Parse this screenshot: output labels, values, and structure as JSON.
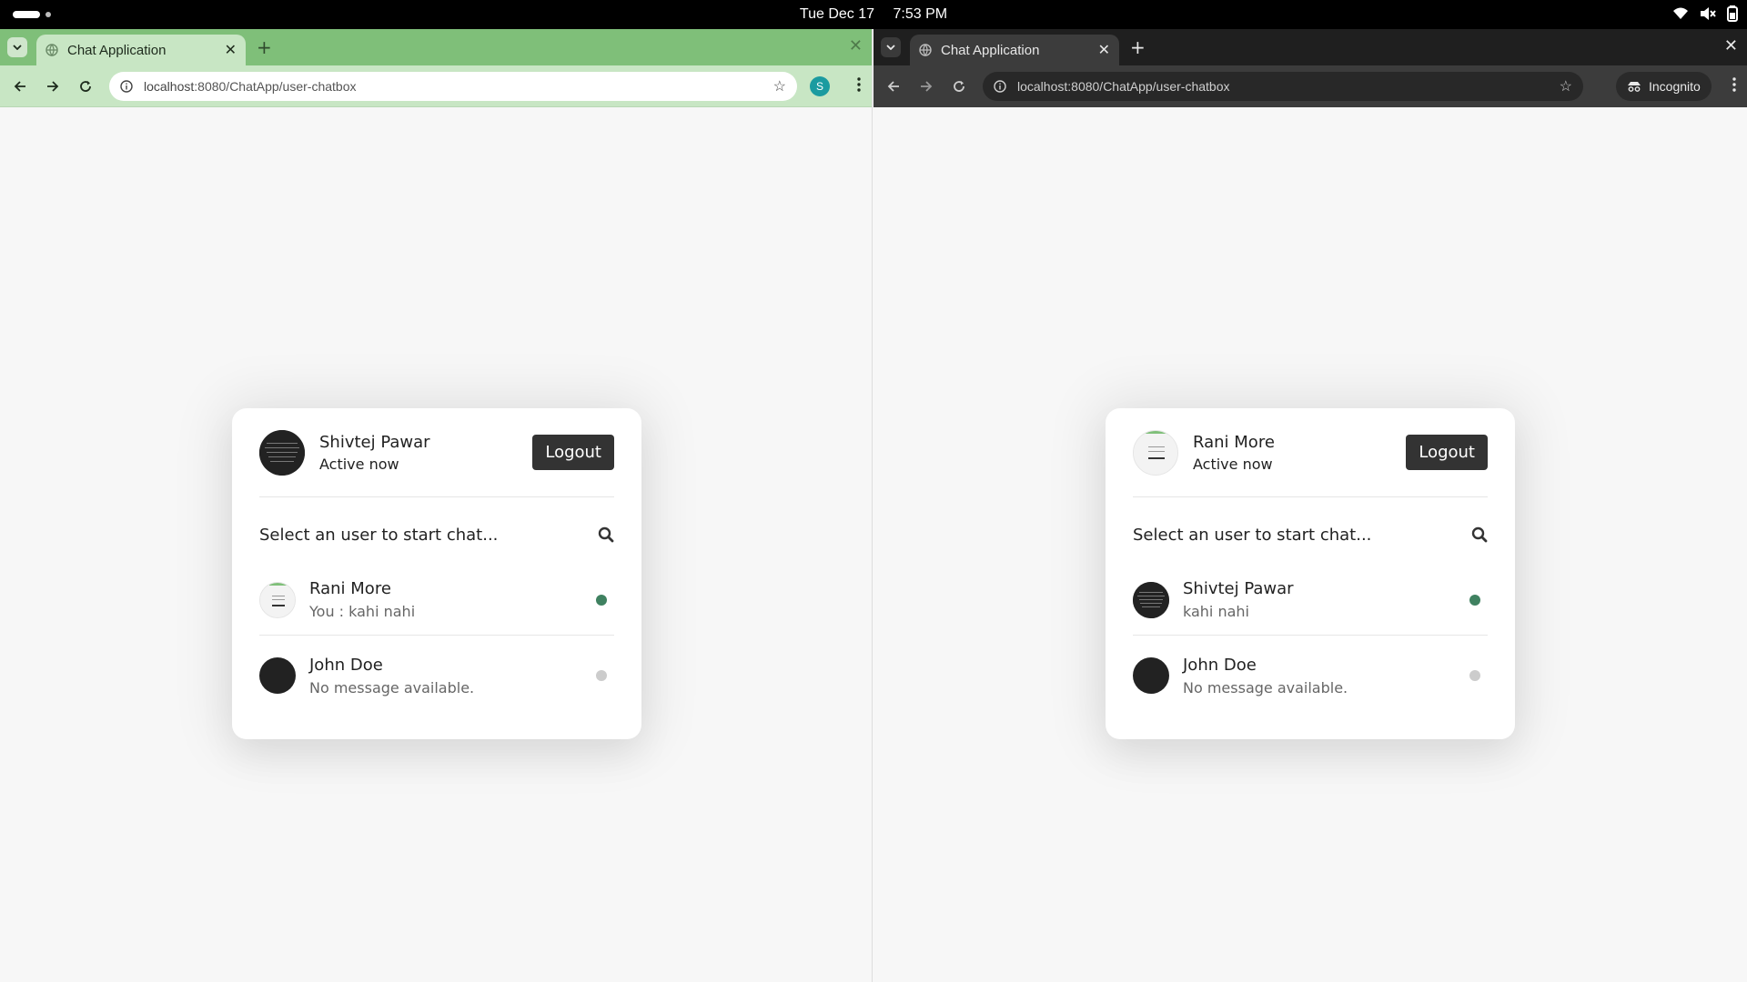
{
  "system": {
    "date": "Tue Dec 17",
    "time": "7:53 PM"
  },
  "windows": {
    "left": {
      "tab_title": "Chat Application",
      "url_host": "localhost",
      "url_path": ":8080/ChatApp/user-chatbox",
      "profile_initial": "S",
      "theme_color": "#7fbf79"
    },
    "right": {
      "tab_title": "Chat Application",
      "url_host": "localhost",
      "url_path": ":8080/ChatApp/user-chatbox",
      "incognito_label": "Incognito",
      "theme_color": "#1f1f1f"
    }
  },
  "chat_left": {
    "current_user": {
      "name": "Shivtej Pawar",
      "status": "Active now"
    },
    "logout_label": "Logout",
    "search_prompt": "Select an user to start chat...",
    "users": [
      {
        "name": "Rani More",
        "message": "You : kahi nahi",
        "status": "online"
      },
      {
        "name": "John Doe",
        "message": "No message available.",
        "status": "offline"
      }
    ]
  },
  "chat_right": {
    "current_user": {
      "name": "Rani More",
      "status": "Active now"
    },
    "logout_label": "Logout",
    "search_prompt": "Select an user to start chat...",
    "users": [
      {
        "name": "Shivtej Pawar",
        "message": "kahi nahi",
        "status": "online"
      },
      {
        "name": "John Doe",
        "message": "No message available.",
        "status": "offline"
      }
    ]
  },
  "colors": {
    "online": "#3f8160",
    "offline": "#cccccc",
    "button": "#333333"
  }
}
